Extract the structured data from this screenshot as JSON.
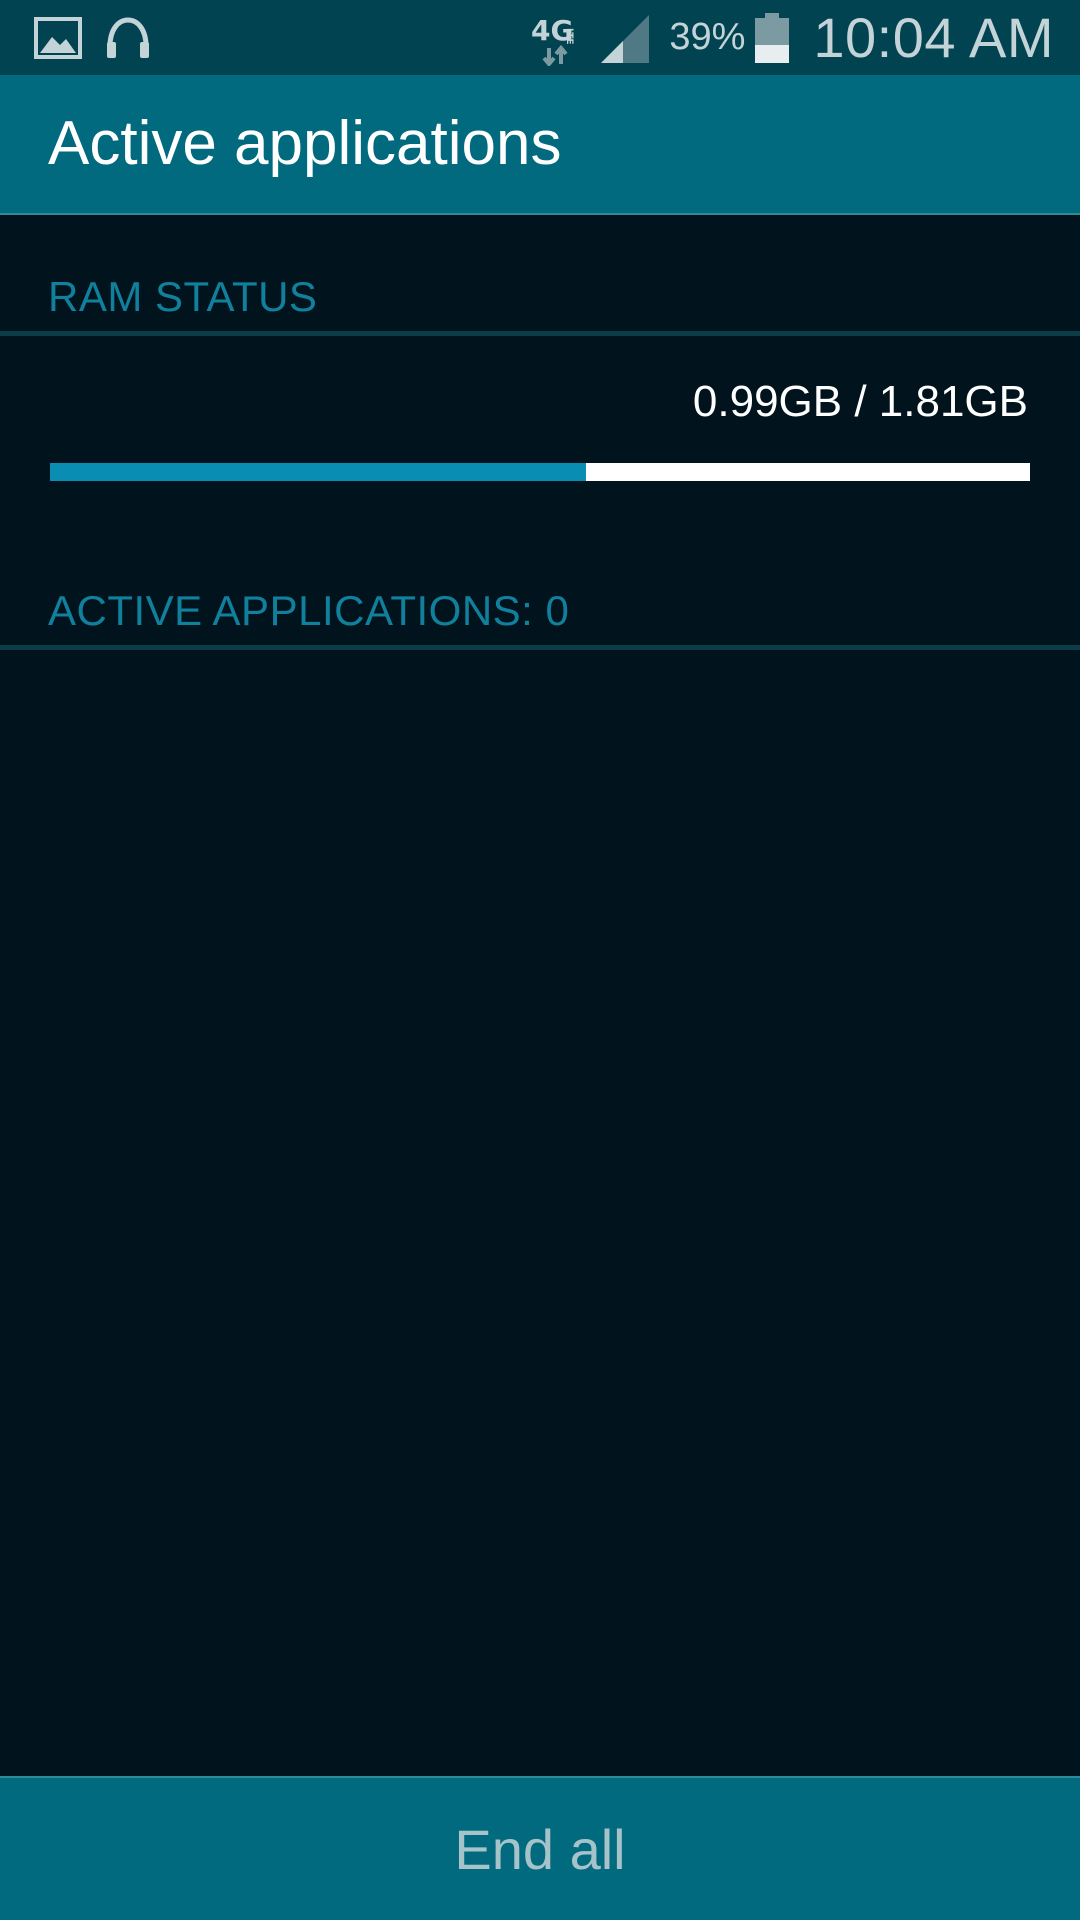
{
  "status_bar": {
    "left_icons": [
      "gallery-icon",
      "headphones-icon"
    ],
    "network_label": "4G",
    "network_sub_label": "LTE",
    "battery_percent_text": "39%",
    "battery_level": 0.39,
    "time": "10:04 AM"
  },
  "app_bar": {
    "title": "Active applications"
  },
  "ram_status": {
    "header": "RAM STATUS",
    "usage_text": "0.99GB / 1.81GB",
    "used_fraction": 0.547
  },
  "active_apps": {
    "header": "ACTIVE APPLICATIONS: 0"
  },
  "footer": {
    "end_all_label": "End all"
  },
  "colors": {
    "status_bar_bg": "#014350",
    "app_bar_bg": "#016a7e",
    "page_bg": "#01141d",
    "accent": "#10809d",
    "bar_fill": "#0a8db3"
  }
}
